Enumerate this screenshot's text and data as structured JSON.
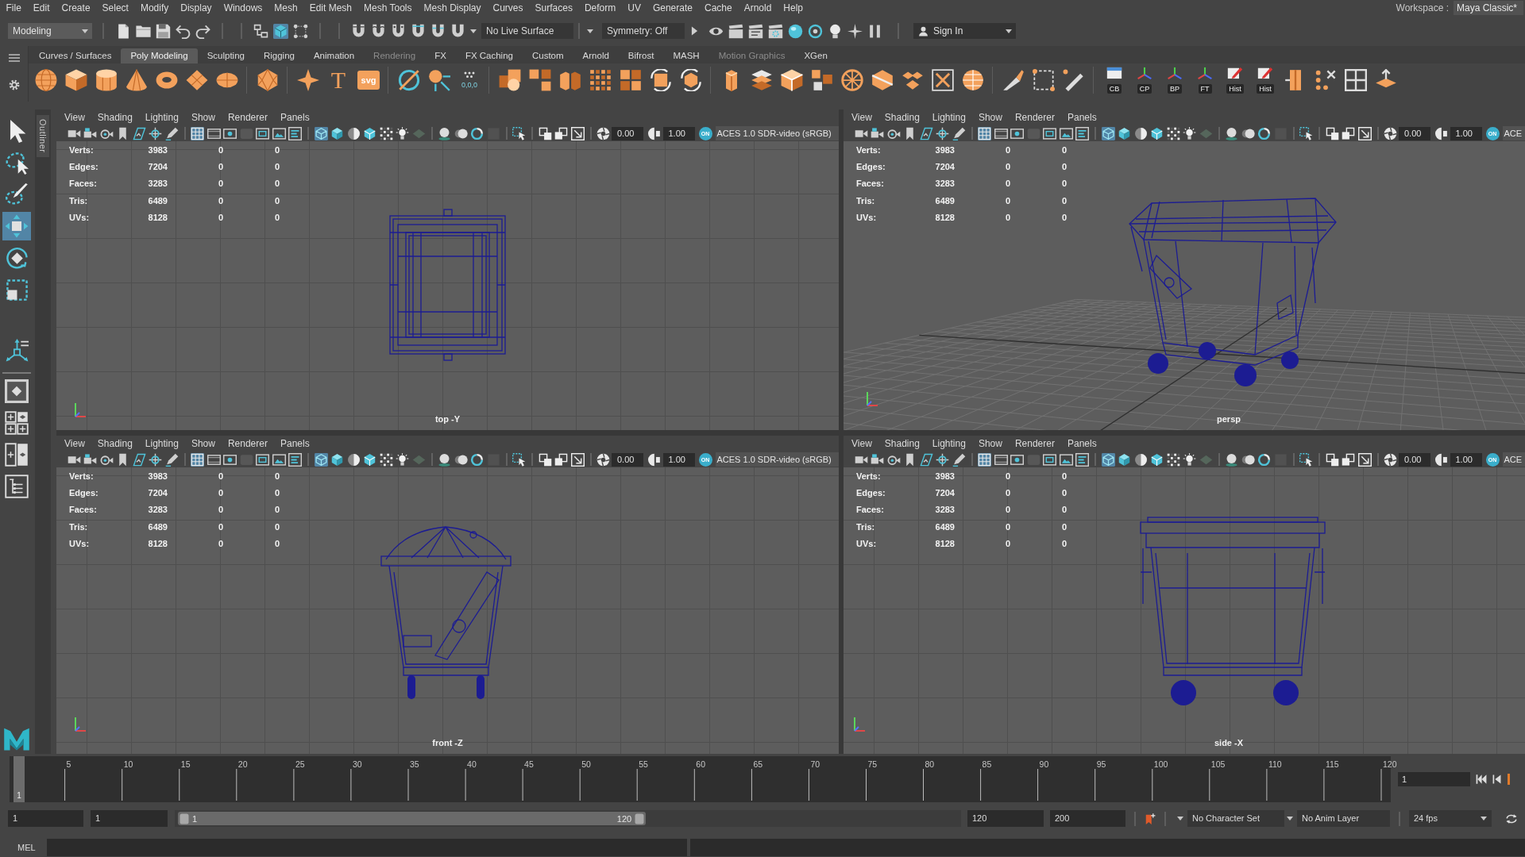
{
  "menu_bar": {
    "menus": [
      "File",
      "Edit",
      "Create",
      "Select",
      "Modify",
      "Display",
      "Windows",
      "Mesh",
      "Edit Mesh",
      "Mesh Tools",
      "Mesh Display",
      "Curves",
      "Surfaces",
      "Deform",
      "UV",
      "Generate",
      "Cache",
      "Arnold",
      "Help"
    ],
    "workspace_label": "Workspace :",
    "workspace": "Maya Classic*"
  },
  "status_line": {
    "menu_set": "Modeling",
    "selection_modes": [
      {
        "selected": false
      },
      {
        "selected": true
      },
      {
        "selected": false
      }
    ],
    "live_surface": "No Live Surface",
    "symmetry": "Symmetry: Off",
    "account": "Sign In"
  },
  "shelf": {
    "tabs": [
      {
        "label": "Curves / Surfaces",
        "selected": false,
        "dimmed": false
      },
      {
        "label": "Poly Modeling",
        "selected": true,
        "dimmed": false
      },
      {
        "label": "Sculpting",
        "selected": false,
        "dimmed": false
      },
      {
        "label": "Rigging",
        "selected": false,
        "dimmed": false
      },
      {
        "label": "Animation",
        "selected": false,
        "dimmed": false
      },
      {
        "label": "Rendering",
        "selected": false,
        "dimmed": true
      },
      {
        "label": "FX",
        "selected": false,
        "dimmed": false
      },
      {
        "label": "FX Caching",
        "selected": false,
        "dimmed": false
      },
      {
        "label": "Custom",
        "selected": false,
        "dimmed": false
      },
      {
        "label": "Arnold",
        "selected": false,
        "dimmed": false
      },
      {
        "label": "Bifrost",
        "selected": false,
        "dimmed": false
      },
      {
        "label": "MASH",
        "selected": false,
        "dimmed": false
      },
      {
        "label": "Motion Graphics",
        "selected": false,
        "dimmed": true
      },
      {
        "label": "XGen",
        "selected": false,
        "dimmed": false
      }
    ],
    "type_button": "T",
    "svg_button": "svg",
    "coordinates_button": "0,0,0",
    "labeled_buttons": [
      "CB",
      "CP",
      "BP",
      "FT",
      "Hist",
      "Hist"
    ]
  },
  "toolbox": {
    "tools": [
      {
        "selected": false
      },
      {
        "selected": false
      },
      {
        "selected": false
      },
      {
        "selected": true
      },
      {
        "selected": false
      },
      {
        "selected": false
      },
      {
        "selected": false
      }
    ]
  },
  "outliner_tab": "Outliner",
  "viewports": [
    {
      "kind": "top",
      "menus": [
        "View",
        "Shading",
        "Lighting",
        "Show",
        "Renderer",
        "Panels"
      ],
      "toolbar": {
        "grid_on": true,
        "wireframe_on": true,
        "exposure": "0.00",
        "gamma": "1.00",
        "color_management": "ON",
        "view_transform": "ACES 1.0 SDR-video (sRGB)"
      },
      "hud": [
        {
          "label": "Verts:",
          "values": [
            "3983",
            "0",
            "0"
          ]
        },
        {
          "label": "Edges:",
          "values": [
            "7204",
            "0",
            "0"
          ]
        },
        {
          "label": "Faces:",
          "values": [
            "3283",
            "0",
            "0"
          ]
        },
        {
          "label": "Tris:",
          "values": [
            "6489",
            "0",
            "0"
          ]
        },
        {
          "label": "UVs:",
          "values": [
            "8128",
            "0",
            "0"
          ]
        }
      ],
      "camera": "top -Y"
    },
    {
      "kind": "persp",
      "menus": [
        "View",
        "Shading",
        "Lighting",
        "Show",
        "Renderer",
        "Panels"
      ],
      "toolbar": {
        "grid_on": true,
        "wireframe_on": true,
        "exposure": "0.00",
        "gamma": "1.00",
        "color_management": "ON",
        "view_transform": "ACE"
      },
      "hud": [
        {
          "label": "Verts:",
          "values": [
            "3983",
            "0",
            "0"
          ]
        },
        {
          "label": "Edges:",
          "values": [
            "7204",
            "0",
            "0"
          ]
        },
        {
          "label": "Faces:",
          "values": [
            "3283",
            "0",
            "0"
          ]
        },
        {
          "label": "Tris:",
          "values": [
            "6489",
            "0",
            "0"
          ]
        },
        {
          "label": "UVs:",
          "values": [
            "8128",
            "0",
            "0"
          ]
        }
      ],
      "camera": "persp"
    },
    {
      "kind": "front",
      "menus": [
        "View",
        "Shading",
        "Lighting",
        "Show",
        "Renderer",
        "Panels"
      ],
      "toolbar": {
        "grid_on": true,
        "wireframe_on": true,
        "exposure": "0.00",
        "gamma": "1.00",
        "color_management": "ON",
        "view_transform": "ACES 1.0 SDR-video (sRGB)"
      },
      "hud": [
        {
          "label": "Verts:",
          "values": [
            "3983",
            "0",
            "0"
          ]
        },
        {
          "label": "Edges:",
          "values": [
            "7204",
            "0",
            "0"
          ]
        },
        {
          "label": "Faces:",
          "values": [
            "3283",
            "0",
            "0"
          ]
        },
        {
          "label": "Tris:",
          "values": [
            "6489",
            "0",
            "0"
          ]
        },
        {
          "label": "UVs:",
          "values": [
            "8128",
            "0",
            "0"
          ]
        }
      ],
      "camera": "front -Z"
    },
    {
      "kind": "side",
      "menus": [
        "View",
        "Shading",
        "Lighting",
        "Show",
        "Renderer",
        "Panels"
      ],
      "toolbar": {
        "grid_on": true,
        "wireframe_on": true,
        "exposure": "0.00",
        "gamma": "1.00",
        "color_management": "ON",
        "view_transform": "ACE"
      },
      "hud": [
        {
          "label": "Verts:",
          "values": [
            "3983",
            "0",
            "0"
          ]
        },
        {
          "label": "Edges:",
          "values": [
            "7204",
            "0",
            "0"
          ]
        },
        {
          "label": "Faces:",
          "values": [
            "3283",
            "0",
            "0"
          ]
        },
        {
          "label": "Tris:",
          "values": [
            "6489",
            "0",
            "0"
          ]
        },
        {
          "label": "UVs:",
          "values": [
            "8128",
            "0",
            "0"
          ]
        }
      ],
      "camera": "side -X"
    }
  ],
  "timeline": {
    "frame_numbers": [
      "5",
      "10",
      "15",
      "20",
      "25",
      "30",
      "35",
      "40",
      "45",
      "50",
      "55",
      "60",
      "65",
      "70",
      "75",
      "80",
      "85",
      "90",
      "95",
      "100",
      "105",
      "110",
      "115",
      "120"
    ],
    "current_frame": "1",
    "level": 0,
    "current_frame_field": "1"
  },
  "range_slider": {
    "start_time": "1",
    "playback_start": "1",
    "range_start": "1",
    "range_end": "120",
    "level": 0.6,
    "playback_end": "120",
    "end_time": "200",
    "character_set": "No Character Set",
    "anim_layer": "No Anim Layer",
    "fps": "24 fps"
  },
  "command_line": {
    "language": "MEL"
  }
}
